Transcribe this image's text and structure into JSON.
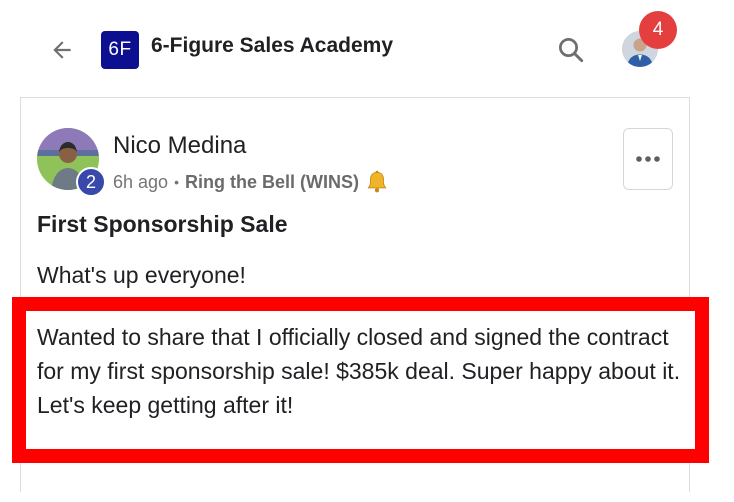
{
  "header": {
    "group_logo_text": "6F",
    "group_name": "6-Figure Sales Academy",
    "notification_count": "4",
    "colors": {
      "logo_bg": "#0c0f8f",
      "badge_bg": "#e53e3e"
    },
    "icons": {
      "back": "back-arrow-icon",
      "search": "search-icon"
    }
  },
  "post": {
    "author_name": "Nico Medina",
    "author_level": "2",
    "time_ago": "6h ago",
    "separator": "•",
    "category": "Ring the Bell (WINS)",
    "category_icon": "bell-icon",
    "title": "First Sponsorship Sale",
    "greeting": "What's up everyone!",
    "body": "Wanted to share that I officially closed and signed the contract for my first sponsorship sale! $385k deal. Super happy about it. Let's keep getting after it!",
    "highlight_color": "#ff0000",
    "more_icon": "more-options-icon"
  }
}
